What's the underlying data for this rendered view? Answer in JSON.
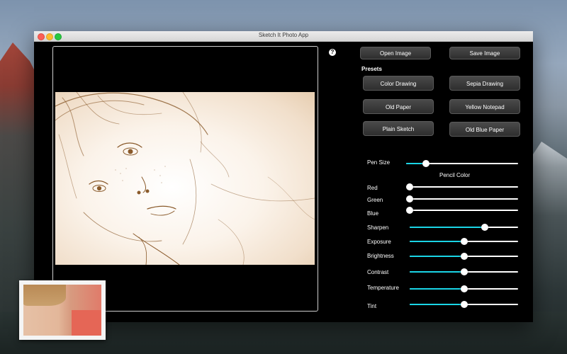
{
  "window": {
    "title": "Sketch It Photo App"
  },
  "toolbar": {
    "help_label": "?",
    "open_label": "Open Image",
    "save_label": "Save Image"
  },
  "presets": {
    "heading": "Presets",
    "items": [
      "Color Drawing",
      "Sepia Drawing",
      "Old Paper",
      "Yellow Notepad",
      "Plain Sketch",
      "Old Blue Paper"
    ]
  },
  "controls": {
    "pen_size": {
      "label": "Pen Size",
      "value": 0.18
    },
    "pencil_color_heading": "Pencil Color",
    "red": {
      "label": "Red",
      "value": 0.0
    },
    "green": {
      "label": "Green",
      "value": 0.0
    },
    "blue": {
      "label": "Blue",
      "value": 0.0
    },
    "sharpen": {
      "label": "Sharpen",
      "value": 0.69
    },
    "exposure": {
      "label": "Exposure",
      "value": 0.5
    },
    "brightness": {
      "label": "Brightness",
      "value": 0.5
    },
    "contrast": {
      "label": "Contrast",
      "value": 0.5
    },
    "temperature": {
      "label": "Temperature",
      "value": 0.5
    },
    "tint": {
      "label": "Tint",
      "value": 0.5
    }
  },
  "colors": {
    "accent": "#1ad5e6",
    "sketch_ink": "#8a5a2b"
  }
}
